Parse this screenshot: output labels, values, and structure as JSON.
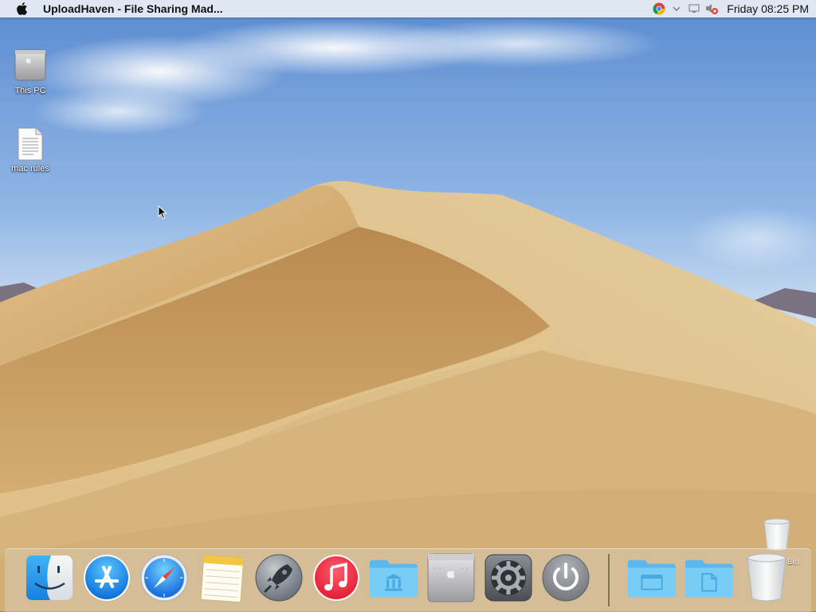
{
  "menubar": {
    "app_title": "UploadHaven - File Sharing Mad...",
    "clock": "Friday 08:25 PM",
    "tray_icons": [
      "chrome-icon",
      "chevron-down-icon",
      "network-icon",
      "volume-muted-icon"
    ]
  },
  "desktop": {
    "icons": [
      {
        "label": "This PC",
        "icon": "computer-icon"
      },
      {
        "label": "mac rules",
        "icon": "text-document-icon"
      }
    ]
  },
  "dock": {
    "items": [
      "finder",
      "app-store",
      "safari",
      "notes",
      "launchpad",
      "itunes",
      "applications-folder",
      "this-pc",
      "system-preferences",
      "power",
      "documents-folder",
      "files-folder",
      "recycle-bin"
    ],
    "bin_label": "Bin"
  },
  "colors": {
    "menubar_bg": "#ebeef4",
    "folder_blue": "#6fc3f2",
    "sky_top": "#5f8fd0",
    "sand": "#d9b67e"
  }
}
